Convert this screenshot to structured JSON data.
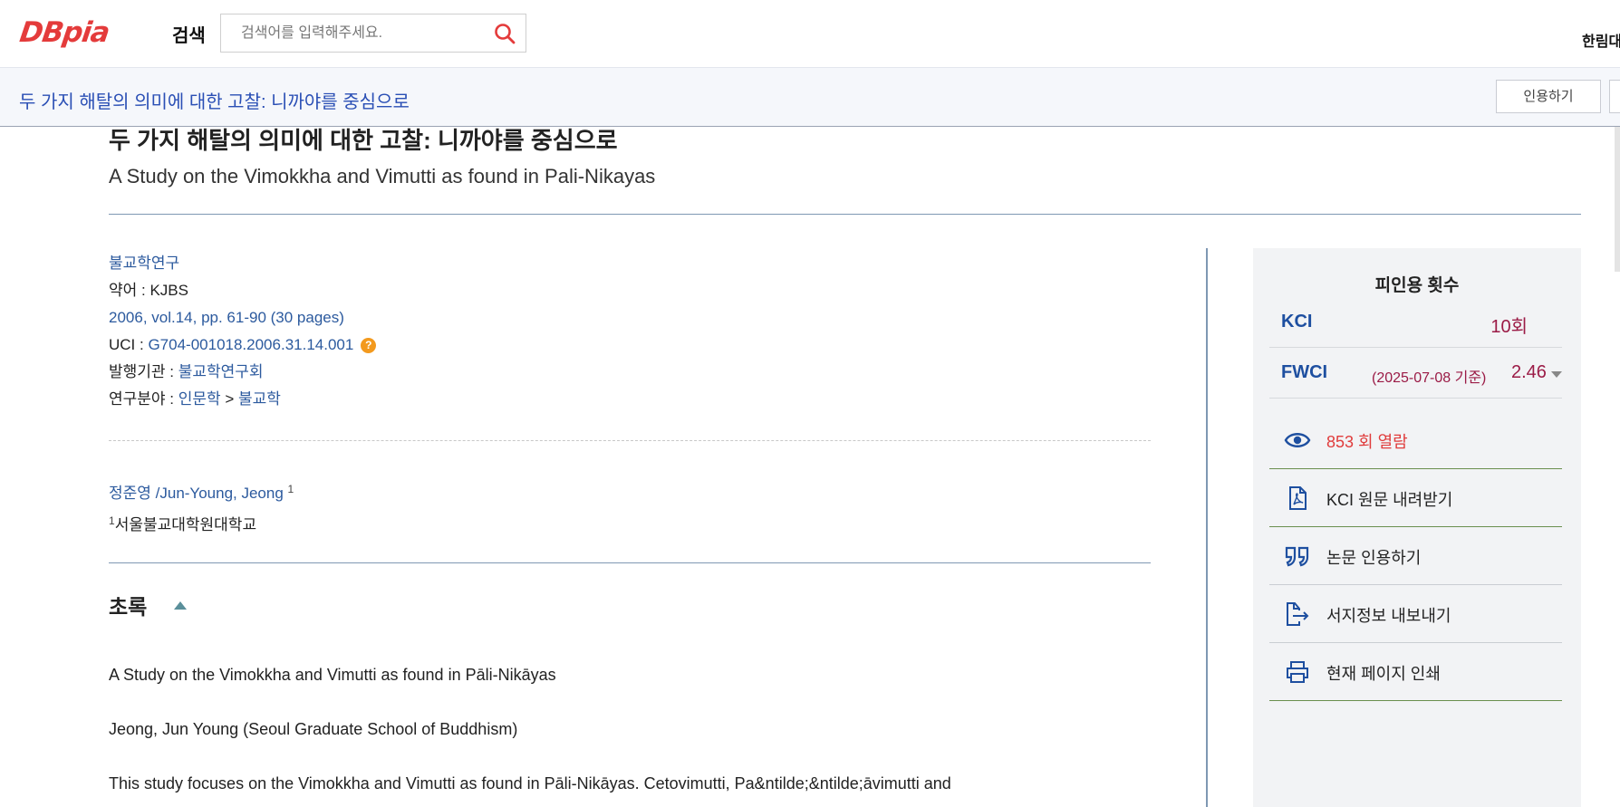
{
  "header": {
    "logo": "DBpia",
    "search_label": "검색",
    "search_placeholder": "검색어를 입력해주세요.",
    "user": "한림대"
  },
  "subbar": {
    "title": "두 가지 해탈의 의미에 대한 고찰: 니까야를 중심으로",
    "cite_button": "인용하기"
  },
  "article": {
    "title_ko": "두 가지 해탈의 의미에 대한 고찰: 니까야를 중심으로",
    "title_en": "A Study on the Vimokkha and Vimutti as found in Pali-Nikayas",
    "journal": "불교학연구",
    "abbr_label": "약어 : ",
    "abbr": "KJBS",
    "volume": "2006, vol.14, pp. 61-90 (30 pages)",
    "uci_label": "UCI : ",
    "uci": "G704-001018.2006.31.14.001",
    "publisher_label": "발행기관 : ",
    "publisher": "불교학연구회",
    "field_label": "연구분야 : ",
    "field_1": "인문학",
    "field_sep": " > ",
    "field_2": "불교학",
    "author": "정준영 /Jun-Young, Jeong",
    "author_sup": "1",
    "affiliation_sup": "1",
    "affiliation": "서울불교대학원대학교"
  },
  "abstract": {
    "heading": "초록",
    "paragraphs": [
      "A Study on the Vimokkha and Vimutti as found in Pāli-Nikāyas",
      "Jeong, Jun Young (Seoul Graduate School of Buddhism)",
      "This study focuses on the Vimokkha and Vimutti as found in Pāli-Nikāyas. Cetovimutti, Pa&ntilde;&ntilde;āvimutti and"
    ]
  },
  "panel": {
    "title": "피인용 횟수",
    "kci_label": "KCI",
    "kci_value": "10회",
    "fwci_label": "FWCI",
    "fwci_date": "(2025-07-08 기준)",
    "fwci_value": "2.46",
    "actions": [
      {
        "icon": "eye-icon",
        "label": "853 회 열람"
      },
      {
        "icon": "pdf-icon",
        "label": "KCI 원문 내려받기"
      },
      {
        "icon": "quote-icon",
        "label": "논문 인용하기"
      },
      {
        "icon": "export-icon",
        "label": "서지정보 내보내기"
      },
      {
        "icon": "print-icon",
        "label": "현재 페이지 인쇄"
      }
    ]
  }
}
